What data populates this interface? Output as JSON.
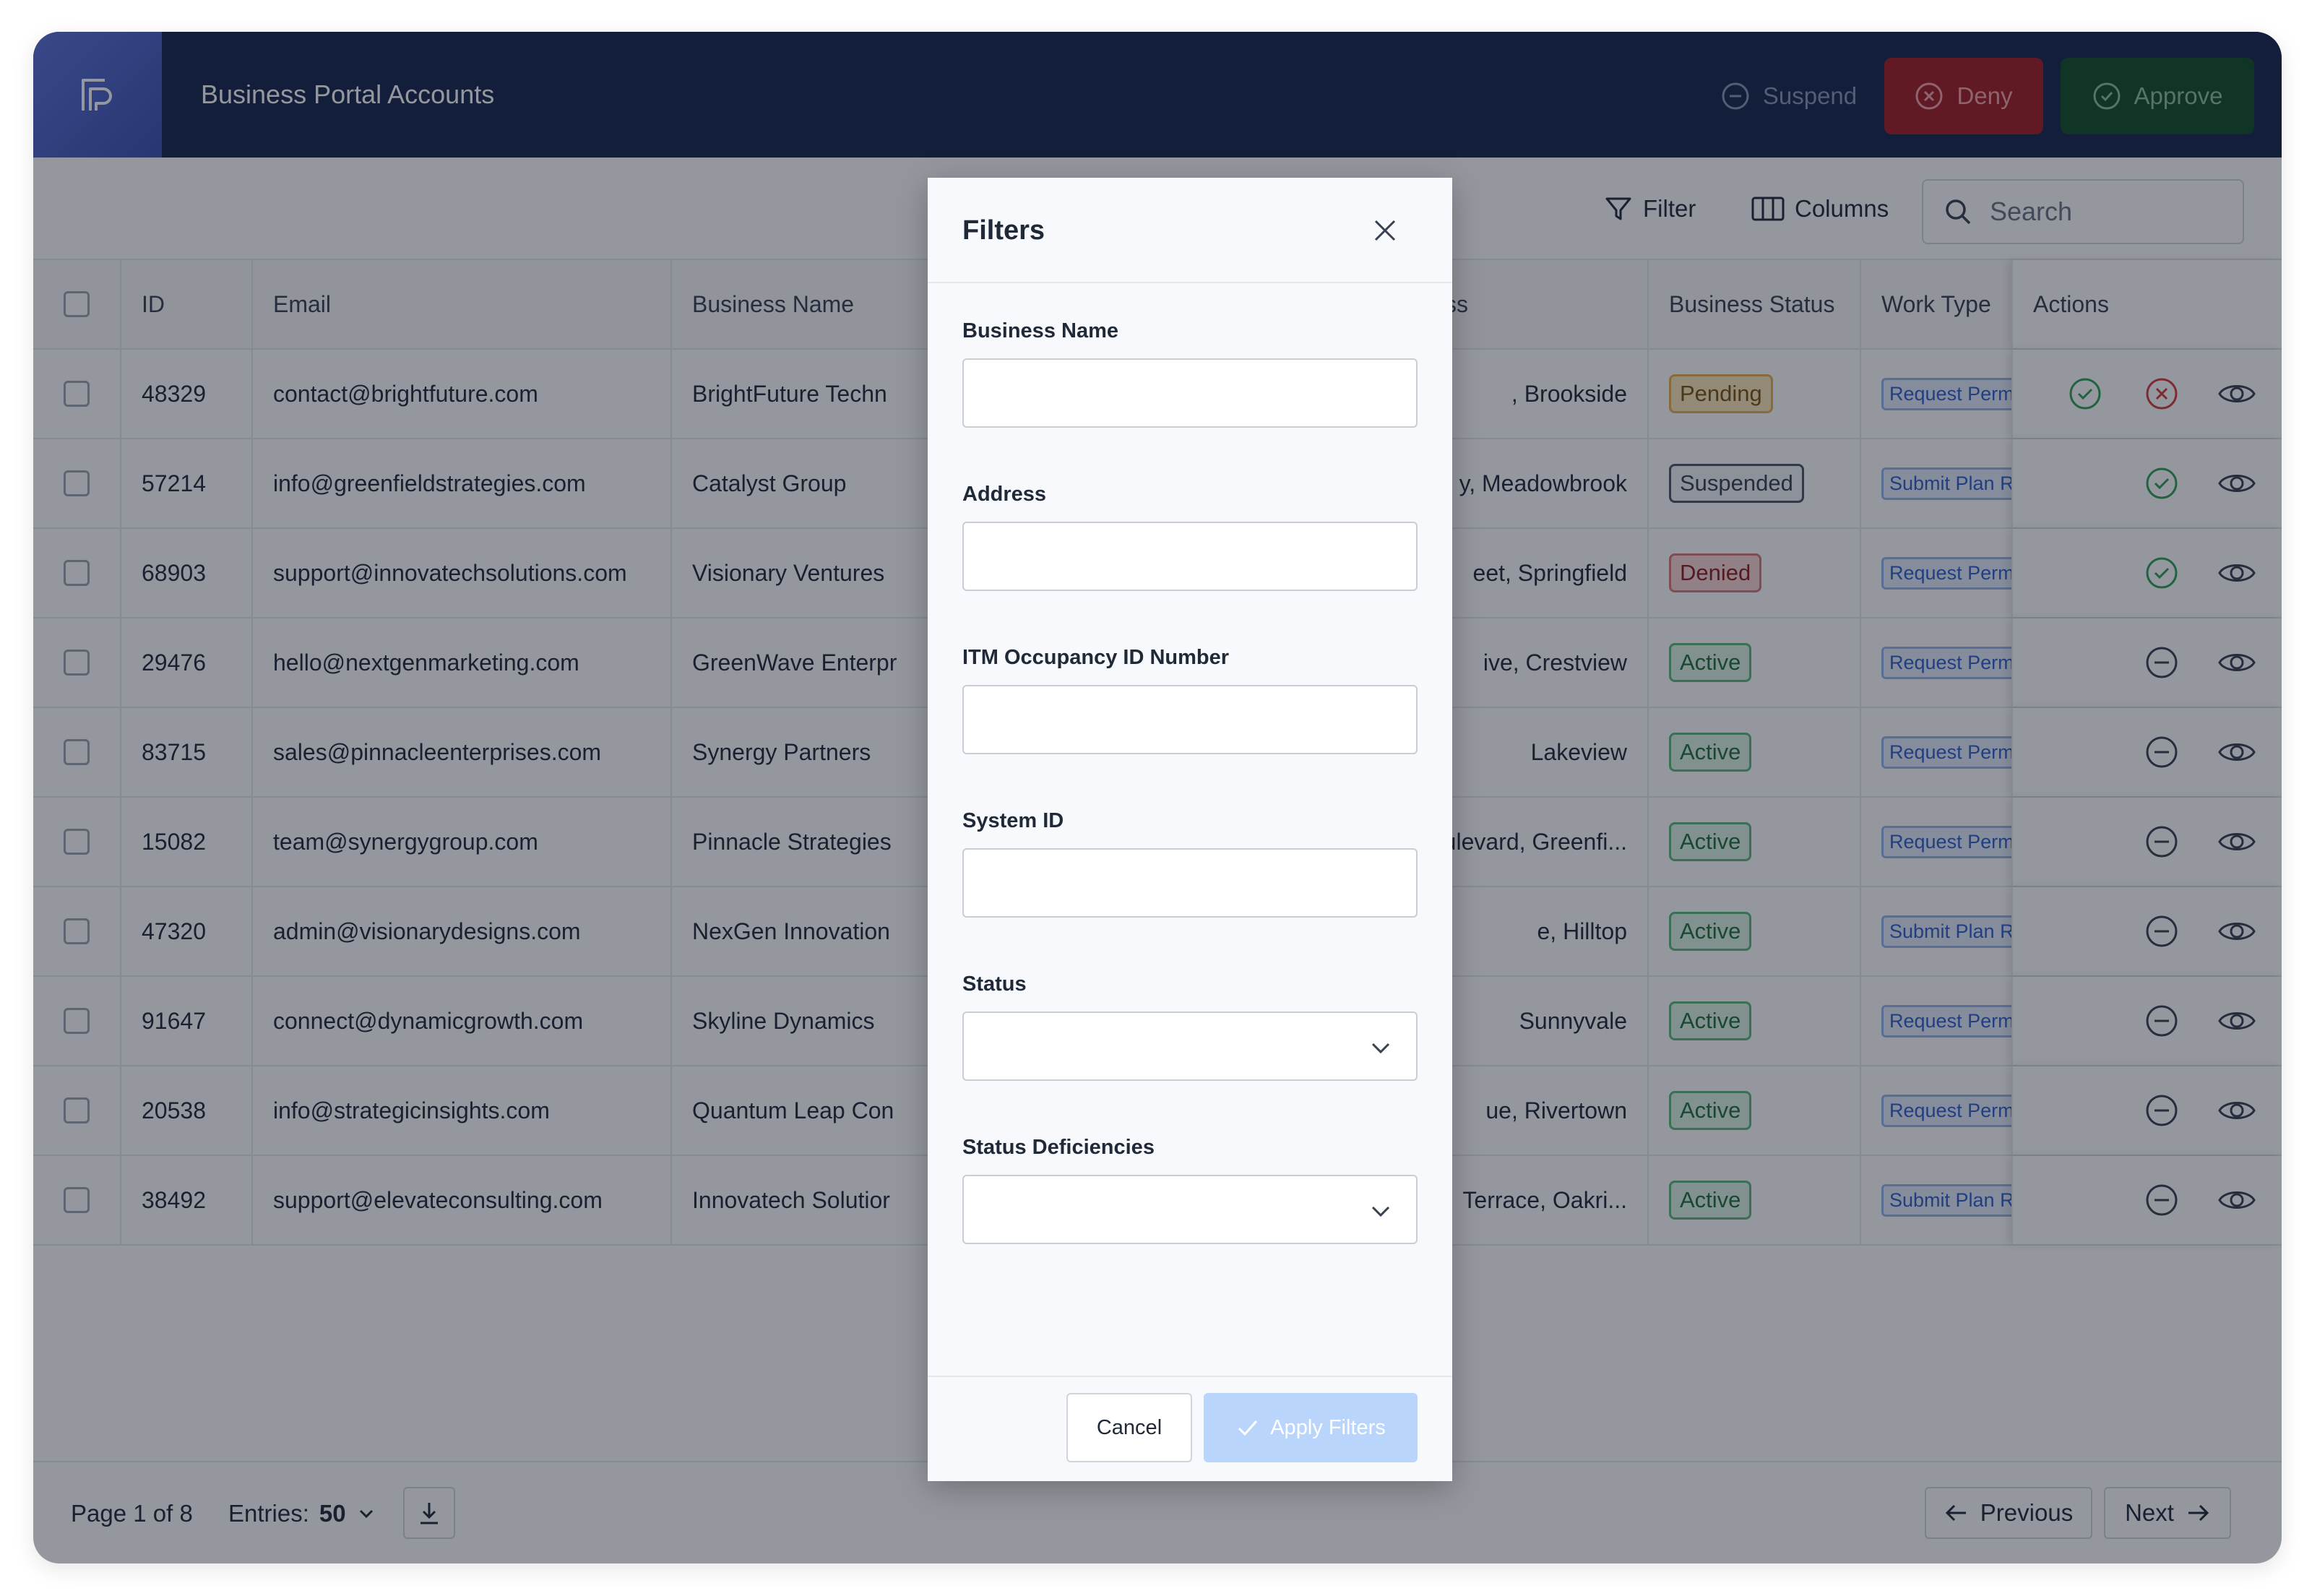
{
  "header": {
    "title": "Business Portal Accounts",
    "suspend_label": "Suspend",
    "deny_label": "Deny",
    "approve_label": "Approve"
  },
  "toolbar": {
    "filter_label": "Filter",
    "columns_label": "Columns",
    "search_placeholder": "Search"
  },
  "table": {
    "headers": {
      "id": "ID",
      "email": "Email",
      "business_name": "Business Name",
      "address_partial": "ss",
      "business_status": "Business Status",
      "work_type": "Work Type",
      "actions": "Actions"
    },
    "rows": [
      {
        "id": "48329",
        "email": "contact@brightfuture.com",
        "business": "BrightFuture Techn",
        "address": ", Brookside",
        "status": "Pending",
        "work": "Request Permits"
      },
      {
        "id": "57214",
        "email": "info@greenfieldstrategies.com",
        "business": "Catalyst Group",
        "address": "y, Meadowbrook",
        "status": "Suspended",
        "work": "Submit Plan Revi"
      },
      {
        "id": "68903",
        "email": "support@innovatechsolutions.com",
        "business": "Visionary Ventures",
        "address": "eet, Springfield",
        "status": "Denied",
        "work": "Request Permits"
      },
      {
        "id": "29476",
        "email": "hello@nextgenmarketing.com",
        "business": "GreenWave Enterpr",
        "address": "ive, Crestview",
        "status": "Active",
        "work": "Request Permits"
      },
      {
        "id": "83715",
        "email": "sales@pinnacleenterprises.com",
        "business": "Synergy Partners",
        "address": "Lakeview",
        "status": "Active",
        "work": "Request Permits"
      },
      {
        "id": "15082",
        "email": "team@synergygroup.com",
        "business": "Pinnacle Strategies",
        "address": "ulevard, Greenfi...",
        "status": "Active",
        "work": "Request Permits"
      },
      {
        "id": "47320",
        "email": "admin@visionarydesigns.com",
        "business": "NexGen Innovation",
        "address": "e, Hilltop",
        "status": "Active",
        "work": "Submit Plan Revi"
      },
      {
        "id": "91647",
        "email": "connect@dynamicgrowth.com",
        "business": "Skyline Dynamics",
        "address": "Sunnyvale",
        "status": "Active",
        "work": "Request Permits"
      },
      {
        "id": "20538",
        "email": "info@strategicinsights.com",
        "business": "Quantum Leap Con",
        "address": "ue, Rivertown",
        "status": "Active",
        "work": "Request Permits"
      },
      {
        "id": "38492",
        "email": "support@elevateconsulting.com",
        "business": "Innovatech Solutior",
        "address": "Terrace, Oakri...",
        "status": "Active",
        "work": "Submit Plan Revi"
      }
    ]
  },
  "footer": {
    "page_text": "Page 1 of 8",
    "entries_label": "Entries:",
    "entries_value": "50",
    "previous_label": "Previous",
    "next_label": "Next"
  },
  "modal": {
    "title": "Filters",
    "fields": {
      "business_name": "Business Name",
      "address": "Address",
      "itm": "ITM Occupancy ID Number",
      "system_id": "System ID",
      "status": "Status",
      "status_deficiencies": "Status Deficiencies"
    },
    "cancel_label": "Cancel",
    "apply_label": "Apply Filters"
  },
  "colors": {
    "header_bg": "#13234a",
    "deny_bg": "#a21a22",
    "approve_bg": "#0f4b23",
    "apply_bg": "#b9d5fb"
  }
}
